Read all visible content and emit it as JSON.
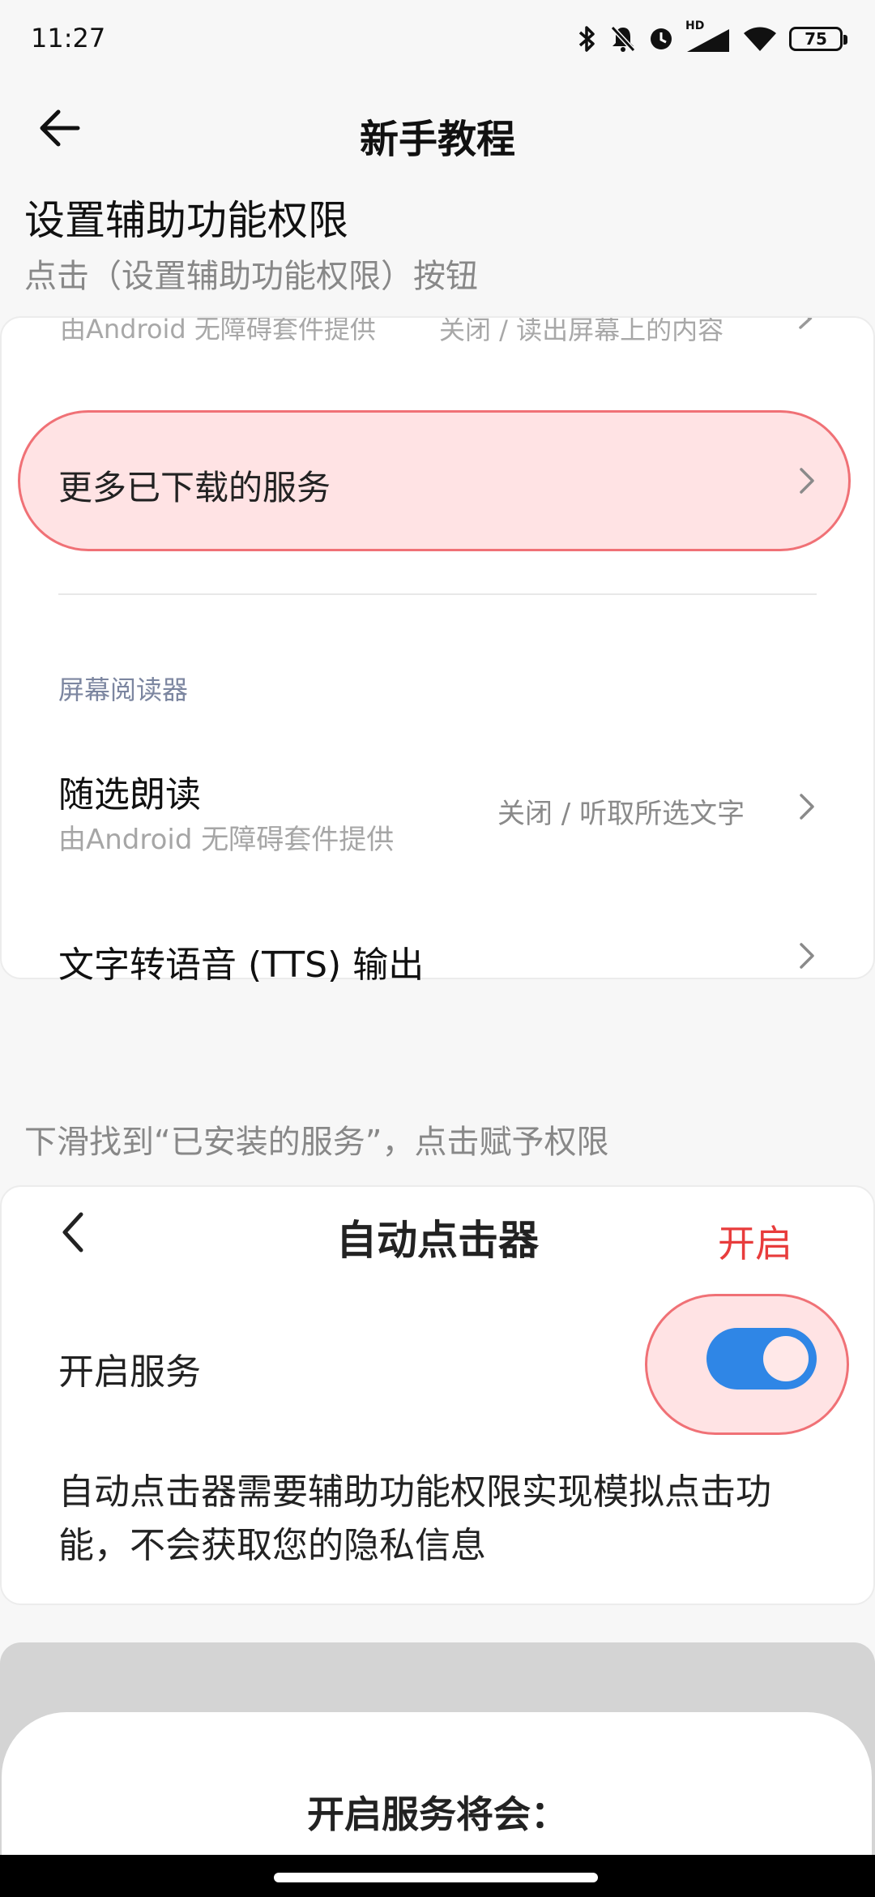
{
  "status_bar": {
    "time": "11:27",
    "hd_label": "HD",
    "battery": "75"
  },
  "header": {
    "title": "新手教程"
  },
  "step": {
    "title": "设置辅助功能权限",
    "description": "点击（设置辅助功能权限）按钮"
  },
  "settings_card": {
    "cut_row_subtitle": "由Android 无障碍套件提供",
    "cut_row_value": "关闭 / 读出屏幕上的内容",
    "highlighted_item": "更多已下载的服务",
    "section_header": "屏幕阅读器",
    "select_to_speak": {
      "title": "随选朗读",
      "subtitle": "由Android 无障碍套件提供",
      "value": "关闭 / 听取所选文字"
    },
    "tts_output": {
      "title": "文字转语音 (TTS) 输出"
    }
  },
  "hint": "下滑找到“已安装的服务”，点击赋予权限",
  "service_card": {
    "title": "自动点击器",
    "action": "开启",
    "toggle_label": "开启服务",
    "toggle_on": true,
    "description": "自动点击器需要辅助功能权限实现模拟点击功能，不会获取您的隐私信息"
  },
  "bottom_sheet": {
    "title": "开启服务将会："
  },
  "colors": {
    "accent_red": "#e83c3c",
    "highlight_fill": "#ffe3e4",
    "highlight_border": "#f07176",
    "toggle_blue": "#2f86e6"
  }
}
